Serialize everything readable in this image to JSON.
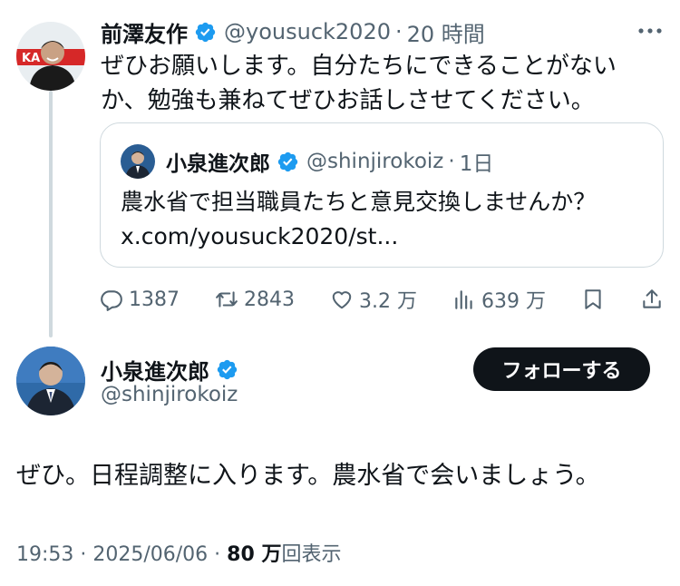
{
  "colors": {
    "verified": "#1d9bf0",
    "text": "#0f1419",
    "secondary": "#536471",
    "border": "#cfd9de",
    "follow_button_bg": "#0f1419"
  },
  "reply_tweet": {
    "author_name": "前澤友作",
    "handle": "@yousuck2020",
    "separator": "·",
    "time": "20 時間",
    "text": "ぜひお願いします。自分たちにできることがないか、勉強も兼ねてぜひお話しさせてください。",
    "avatar_badge_text": "KA",
    "quote": {
      "author_name": "小泉進次郎",
      "handle": "@shinjirokoiz",
      "separator": "·",
      "time": "1日",
      "text_line1": "農水省で担当職員たちと意見交換しませんか？",
      "text_line2": "x.com/yousuck2020/st..."
    },
    "actions": {
      "replies": "1387",
      "reposts": "2843",
      "likes": "3.2 万",
      "views": "639 万"
    }
  },
  "main_tweet": {
    "author_name": "小泉進次郎",
    "handle": "@shinjirokoiz",
    "follow_label": "フォローする",
    "text": "ぜひ。日程調整に入ります。農水省で会いましょう。",
    "timestamp": "19:53 · 2025/06/06 · ",
    "views_count": "80 万",
    "views_label": "回表示"
  },
  "icons": {
    "verified": "verified-badge-icon",
    "more": "more-icon",
    "reply": "reply-icon",
    "repost": "repost-icon",
    "like": "heart-icon",
    "views": "views-icon",
    "bookmark": "bookmark-icon",
    "share": "share-icon"
  }
}
